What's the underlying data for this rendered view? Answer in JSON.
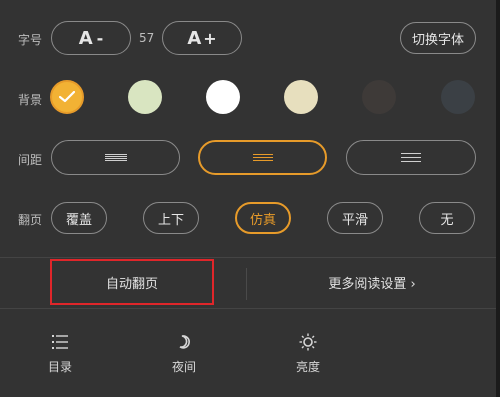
{
  "font_size": {
    "label": "字号",
    "decrease_label": "A",
    "decrease_symbol": "-",
    "value": "57",
    "increase_label": "A",
    "increase_symbol": "+",
    "switch_font_label": "切换字体"
  },
  "background": {
    "label": "背景",
    "selected_index": 0,
    "colors": [
      "#f2b234",
      "#d9e5c1",
      "#ffffff",
      "#e7dfbe",
      "#3e3a38",
      "#3b4045"
    ]
  },
  "spacing": {
    "label": "间距",
    "selected_index": 1
  },
  "page_turn": {
    "label": "翻页",
    "options": [
      "覆盖",
      "上下",
      "仿真",
      "平滑",
      "无"
    ],
    "selected_index": 2
  },
  "actions": {
    "auto_page_turn": "自动翻页",
    "more_settings": "更多阅读设置 ›"
  },
  "tabs": [
    {
      "label": "目录",
      "icon": "list-icon"
    },
    {
      "label": "夜间",
      "icon": "moon-icon"
    },
    {
      "label": "亮度",
      "icon": "sun-icon"
    }
  ],
  "colors": {
    "accent": "#e79b2a",
    "highlight": "#e0262a",
    "panel": "#333333"
  }
}
